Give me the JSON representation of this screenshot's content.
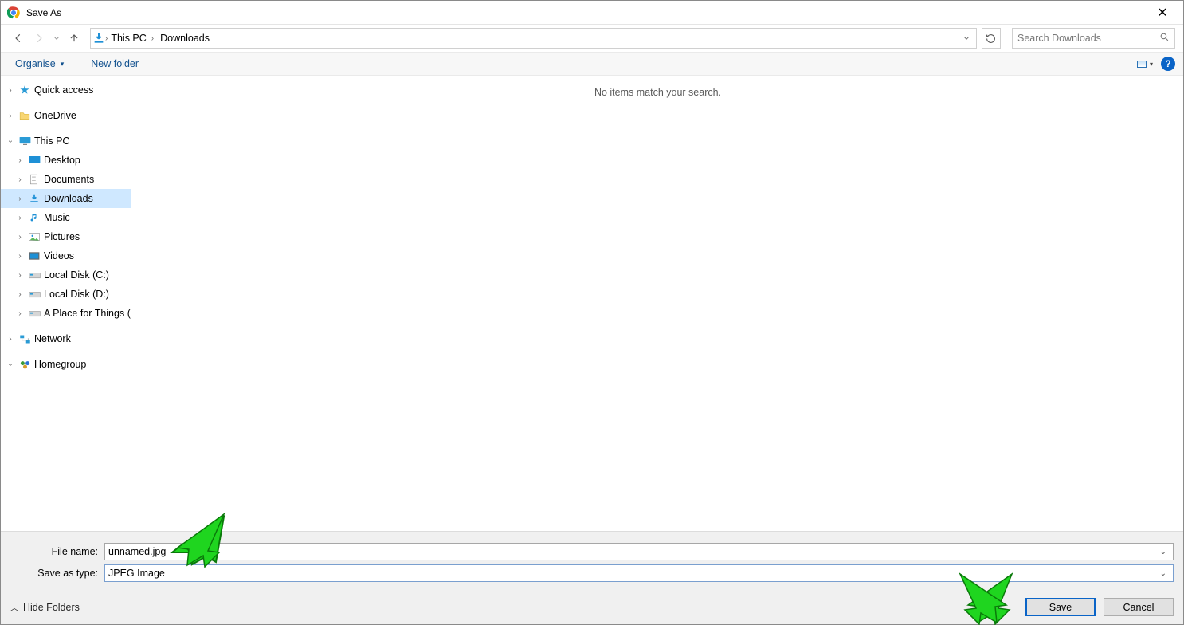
{
  "title": "Save As",
  "nav": {
    "crumbs": [
      "This PC",
      "Downloads"
    ]
  },
  "search": {
    "placeholder": "Search Downloads"
  },
  "toolbar": {
    "organise": "Organise",
    "newfolder": "New folder"
  },
  "tree": {
    "quick_access": "Quick access",
    "onedrive": "OneDrive",
    "this_pc": "This PC",
    "desktop": "Desktop",
    "documents": "Documents",
    "downloads": "Downloads",
    "music": "Music",
    "pictures": "Pictures",
    "videos": "Videos",
    "local_c": "Local Disk (C:)",
    "local_d": "Local Disk (D:)",
    "place": "A Place for Things (",
    "network": "Network",
    "homegroup": "Homegroup"
  },
  "content": {
    "empty": "No items match your search."
  },
  "form": {
    "filename_label": "File name:",
    "filename_value": "unnamed.jpg",
    "type_label": "Save as type:",
    "type_value": "JPEG Image"
  },
  "footer": {
    "hide_folders": "Hide Folders",
    "save": "Save",
    "cancel": "Cancel"
  }
}
